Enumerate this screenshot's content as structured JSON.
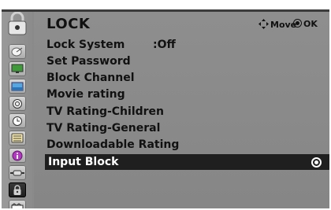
{
  "header": {
    "title": "LOCK",
    "move_label": "Move",
    "ok_label": "OK",
    "move_icon": "four-way-arrow-icon",
    "ok_icon": "ok-button-icon"
  },
  "menu": {
    "items": [
      {
        "label": "Lock System",
        "value": ":Off"
      },
      {
        "label": "Set Password"
      },
      {
        "label": "Block Channel"
      },
      {
        "label": "Movie rating"
      },
      {
        "label": "TV Rating-Children"
      },
      {
        "label": "TV Rating-General"
      },
      {
        "label": "Downloadable Rating"
      },
      {
        "label": "Input Block",
        "selected": true
      }
    ]
  },
  "sidebar": {
    "icons": [
      "lock-icon",
      "satellite-dish-icon",
      "tv-picture-icon",
      "picture-icon",
      "audio-icon",
      "time-icon",
      "option-icon",
      "information-icon",
      "input-icon",
      "lock-icon",
      "channel-icon"
    ],
    "active_icon": "lock-icon"
  },
  "colors": {
    "panel": "#8a8a8a",
    "selected_bar": "#1f1f1f",
    "text": "#111111",
    "selected_text": "#ffffff"
  }
}
